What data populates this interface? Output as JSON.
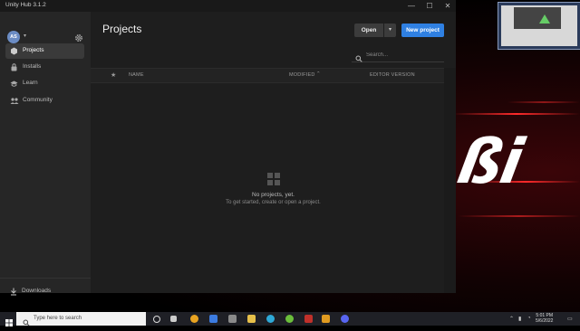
{
  "window": {
    "title": "Unity Hub 3.1.2",
    "minimize": "—",
    "maximize": "☐",
    "close": "✕"
  },
  "sidebar": {
    "avatar_initials": "AS",
    "items": [
      {
        "label": "Projects",
        "icon": "cube-icon",
        "active": true
      },
      {
        "label": "Installs",
        "icon": "lock-icon"
      },
      {
        "label": "Learn",
        "icon": "graduation-cap-icon"
      },
      {
        "label": "Community",
        "icon": "people-icon"
      }
    ],
    "downloads_label": "Downloads"
  },
  "main": {
    "title": "Projects",
    "open_label": "Open",
    "new_project_label": "New project",
    "search_placeholder": "Search...",
    "columns": {
      "name": "NAME",
      "modified": "MODIFIED",
      "editor_version": "EDITOR VERSION"
    },
    "empty_title": "No projects, yet.",
    "empty_subtitle": "To get started, create or open a project."
  },
  "taskbar": {
    "search_placeholder": "Type here to search",
    "time": "5:01 PM",
    "date": "5/6/2022"
  },
  "colors": {
    "accent": "#2f80e2",
    "window_bg": "#1e1e1e",
    "sidebar_bg": "#262626"
  }
}
